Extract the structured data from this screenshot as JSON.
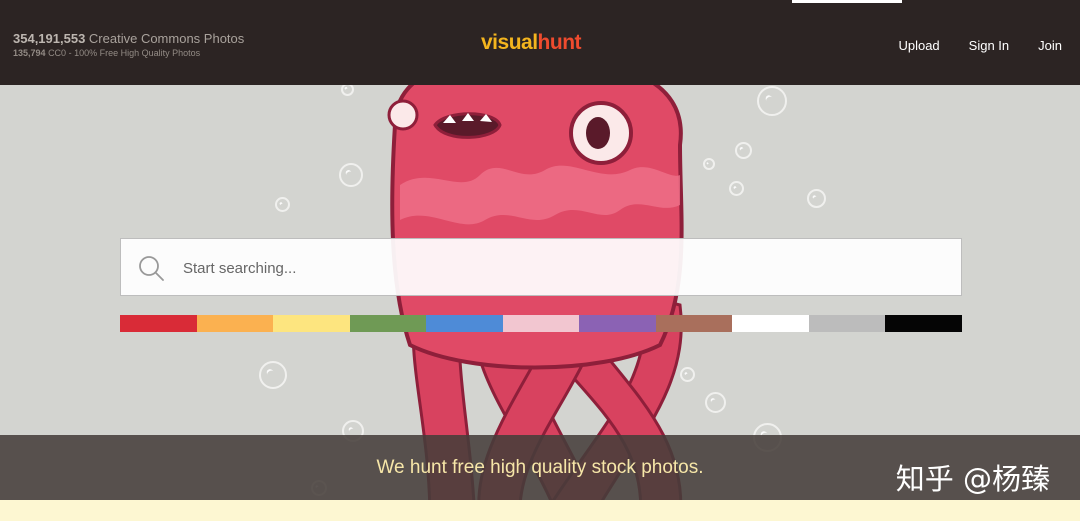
{
  "header": {
    "stats_count": "354,191,553",
    "stats_label": "Creative Commons Photos",
    "sub_count": "135,794",
    "sub_label": "CC0 - 100% Free High Quality Photos",
    "logo_visual": "visual",
    "logo_hunt": "hunt",
    "nav": [
      "Upload",
      "Sign In",
      "Join"
    ]
  },
  "search": {
    "placeholder": "Start searching...",
    "icon": "search-icon"
  },
  "colors": [
    "#d92b37",
    "#fbb150",
    "#fde57f",
    "#6f9a55",
    "#4e8bd7",
    "#f2c6d0",
    "#8b62b4",
    "#a96f5c",
    "#ffffff",
    "#bcbcbc",
    "#050505"
  ],
  "banner": {
    "tagline": "We hunt free high quality stock photos."
  },
  "watermark": "知乎 @杨臻",
  "theme": {
    "header_bg": "#2c2423",
    "accent_yellow": "#f4b51e",
    "accent_red": "#ef4b2e",
    "octopus_pink": "#e04a66"
  }
}
